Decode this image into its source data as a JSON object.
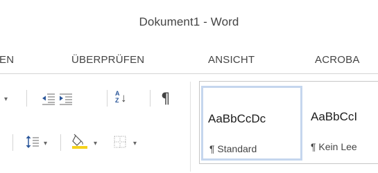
{
  "window": {
    "title": "Dokument1 - Word"
  },
  "tabs": [
    {
      "label": "EN"
    },
    {
      "label": "ÜBERPRÜFEN"
    },
    {
      "label": "ANSICHT"
    },
    {
      "label": "ACROBA"
    }
  ],
  "paragraph_group": {
    "buttons": [
      {
        "icon": "decrease-indent-icon"
      },
      {
        "icon": "increase-indent-icon"
      },
      {
        "icon": "sort-az-icon"
      },
      {
        "icon": "pilcrow-icon"
      },
      {
        "icon": "line-spacing-icon"
      },
      {
        "icon": "shading-bucket-icon"
      },
      {
        "icon": "borders-icon"
      }
    ],
    "dropdown_glyph": "▾",
    "pilcrow_glyph": "¶",
    "sort_glyph_top": "A",
    "sort_glyph_bottom": "Z",
    "sort_arrow": "↓"
  },
  "styles_gallery": {
    "items": [
      {
        "preview": "AaBbCcDc",
        "name": "¶ Standard",
        "selected": true
      },
      {
        "preview": "AaBbCcI",
        "name": "¶ Kein Lee",
        "selected": false
      }
    ]
  },
  "colors": {
    "selected_border": "#c5d6ee",
    "blue_icon": "#2b579a",
    "bucket_yellow": "#f5d21c"
  }
}
